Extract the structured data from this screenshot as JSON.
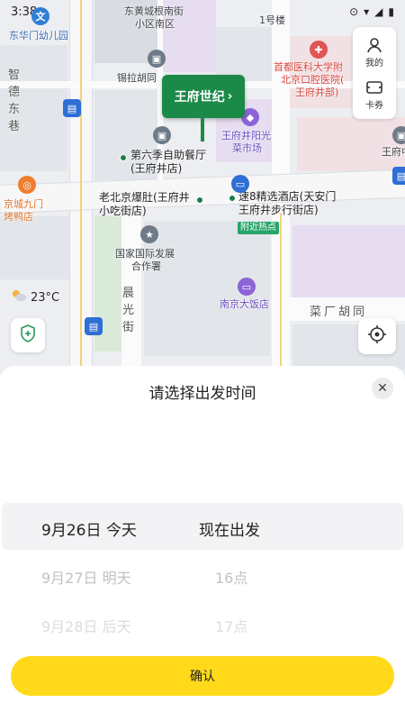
{
  "status_bar": {
    "time": "3:38"
  },
  "map": {
    "labels": {
      "dongcheng_kindergarten": "东华门幼儿园",
      "dongchenggen_south": "东黄城根南街",
      "community_south": "小区南区",
      "building1": "1号楼",
      "xila_hutong": "锡拉胡同",
      "hospital_line1": "首都医科大学附",
      "hospital_line2": "北京口腔医院(",
      "hospital_line3": "王府井部)",
      "wangfujing_yangguang_1": "王府井阳光",
      "wangfujing_yangguang_2": "菜市场",
      "wangfu_right": "王府中",
      "zhide_dong_xiang": "智德东巷",
      "restaurant6_1": "第六季自助餐厅",
      "restaurant6_2": "(王府井店)",
      "roast_duck_1": "京城九门",
      "roast_duck_2": "烤鸭店",
      "laobeijing_1": "老北京爆肚(王府井",
      "laobeijing_2": "小吃街店)",
      "speed8_1": "速8精选酒店(天安门",
      "speed8_2": "王府井步行街店)",
      "nearby_hot": "附近热点",
      "guojia_1": "国家国际发展",
      "guojia_2": "合作署",
      "chenguangjie": "晨光街",
      "nanjing_hotel": "南京大饭店",
      "caichang_hutong": "菜厂胡同"
    },
    "callout_label": "王府世纪",
    "side_panel": {
      "mine_label": "我的",
      "card_label": "卡券"
    },
    "weather": {
      "temperature": "23°C"
    }
  },
  "sheet": {
    "title": "请选择出发时间",
    "date_options": [
      "9月26日 今天",
      "9月27日 明天",
      "9月28日 后天"
    ],
    "time_options": [
      "现在出发",
      "16点",
      "17点"
    ],
    "selected_date": "9月26日 今天",
    "selected_time": "现在出发",
    "confirm_label": "确认"
  },
  "colors": {
    "accent": "#ffd91a",
    "marker": "#1b8a48"
  }
}
